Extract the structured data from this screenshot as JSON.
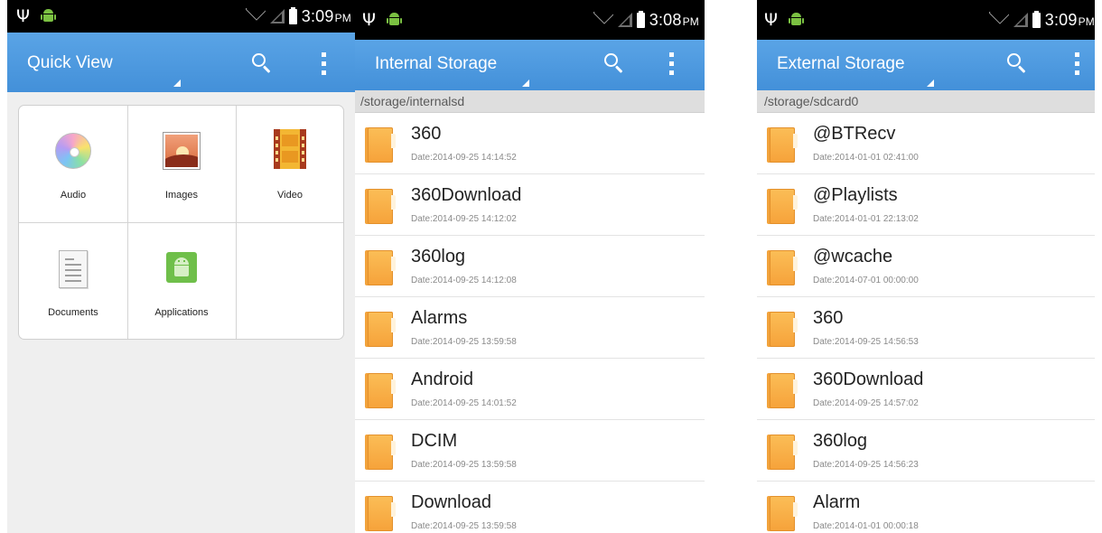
{
  "colors": {
    "action_bar": "#4a96dd",
    "status_bar": "#000000",
    "folder": "#f6a83e",
    "path_bar": "#dedede"
  },
  "icons": {
    "status_left": [
      "usb-icon",
      "android-icon"
    ],
    "status_right": [
      "wifi-icon",
      "signal-icon",
      "battery-icon"
    ],
    "action_bar": [
      "dropdown-indicator",
      "search-icon",
      "overflow-menu-icon"
    ],
    "usb_glyph": "Ψ"
  },
  "screens": {
    "quick_view": {
      "time": "3:09",
      "ampm": "PM",
      "title": "Quick View",
      "tiles": [
        {
          "label": "Audio",
          "icon": "cd-icon"
        },
        {
          "label": "Images",
          "icon": "image-icon"
        },
        {
          "label": "Video",
          "icon": "film-icon"
        },
        {
          "label": "Documents",
          "icon": "document-icon"
        },
        {
          "label": "Applications",
          "icon": "android-app-icon"
        }
      ]
    },
    "internal": {
      "time": "3:08",
      "ampm": "PM",
      "title": "Internal Storage",
      "path": "/storage/internalsd",
      "items": [
        {
          "name": "360",
          "date": "Date:2014-09-25 14:14:52"
        },
        {
          "name": "360Download",
          "date": "Date:2014-09-25 14:12:02"
        },
        {
          "name": "360log",
          "date": "Date:2014-09-25 14:12:08"
        },
        {
          "name": "Alarms",
          "date": "Date:2014-09-25 13:59:58"
        },
        {
          "name": "Android",
          "date": "Date:2014-09-25 14:01:52"
        },
        {
          "name": "DCIM",
          "date": "Date:2014-09-25 13:59:58"
        },
        {
          "name": "Download",
          "date": "Date:2014-09-25 13:59:58"
        }
      ]
    },
    "external": {
      "time": "3:09",
      "ampm": "PM",
      "title": "External Storage",
      "path": "/storage/sdcard0",
      "items": [
        {
          "name": "@BTRecv",
          "date": "Date:2014-01-01 02:41:00"
        },
        {
          "name": "@Playlists",
          "date": "Date:2014-01-01 22:13:02"
        },
        {
          "name": "@wcache",
          "date": "Date:2014-07-01 00:00:00"
        },
        {
          "name": "360",
          "date": "Date:2014-09-25 14:56:53"
        },
        {
          "name": "360Download",
          "date": "Date:2014-09-25 14:57:02"
        },
        {
          "name": "360log",
          "date": "Date:2014-09-25 14:56:23"
        },
        {
          "name": "Alarm",
          "date": "Date:2014-01-01 00:00:18"
        }
      ]
    }
  }
}
